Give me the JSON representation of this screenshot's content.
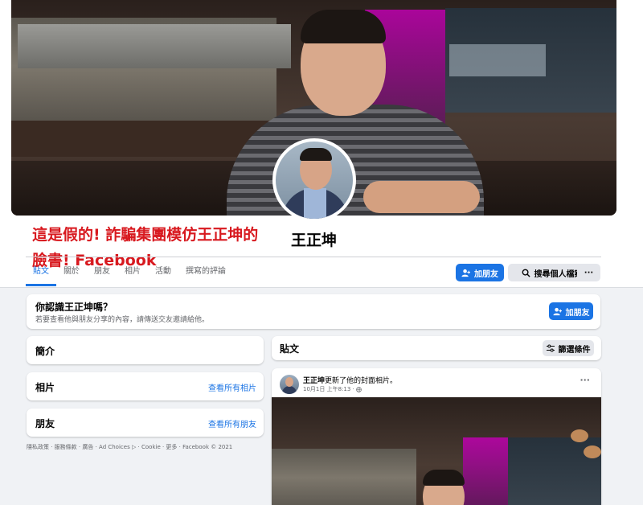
{
  "profile": {
    "name": "王正坤"
  },
  "warning": {
    "line1": "這是假的! 詐騙集團模仿王正坤的",
    "line2": "臉書! Facebook"
  },
  "tabs": [
    {
      "label": "貼文",
      "active": true
    },
    {
      "label": "關於",
      "active": false
    },
    {
      "label": "朋友",
      "active": false
    },
    {
      "label": "相片",
      "active": false
    },
    {
      "label": "活動",
      "active": false
    },
    {
      "label": "撰寫的評論",
      "active": false
    }
  ],
  "actions": {
    "add_friend": "加朋友",
    "search_profile": "搜尋個人檔案",
    "more": "···"
  },
  "know_card": {
    "title": "你認識王正坤嗎？",
    "subtitle": "若要查看他與朋友分享的內容，請傳送交友邀請給他。",
    "button": "加朋友"
  },
  "sidebar": {
    "intro": {
      "title": "簡介"
    },
    "photos": {
      "title": "相片",
      "link": "查看所有相片"
    },
    "friends": {
      "title": "朋友",
      "link": "查看所有朋友"
    }
  },
  "footer": "隱私政策 · 服務條款 · 廣告 · Ad Choices ▷ · Cookie · 更多 · Facebook © 2021",
  "posts": {
    "title": "貼文",
    "filter": "篩選條件",
    "post": {
      "author": "王正坤",
      "action": "更新了他的封面相片。",
      "time": "10月1日 上午8:13 · ",
      "more": "···"
    }
  },
  "colors": {
    "accent": "#1b74e4",
    "warning": "#d8191f",
    "background": "#f0f2f5"
  },
  "icons": {
    "add_friend": "person-add-icon",
    "search": "search-icon",
    "filter": "sliders-icon",
    "privacy": "globe-icon"
  }
}
